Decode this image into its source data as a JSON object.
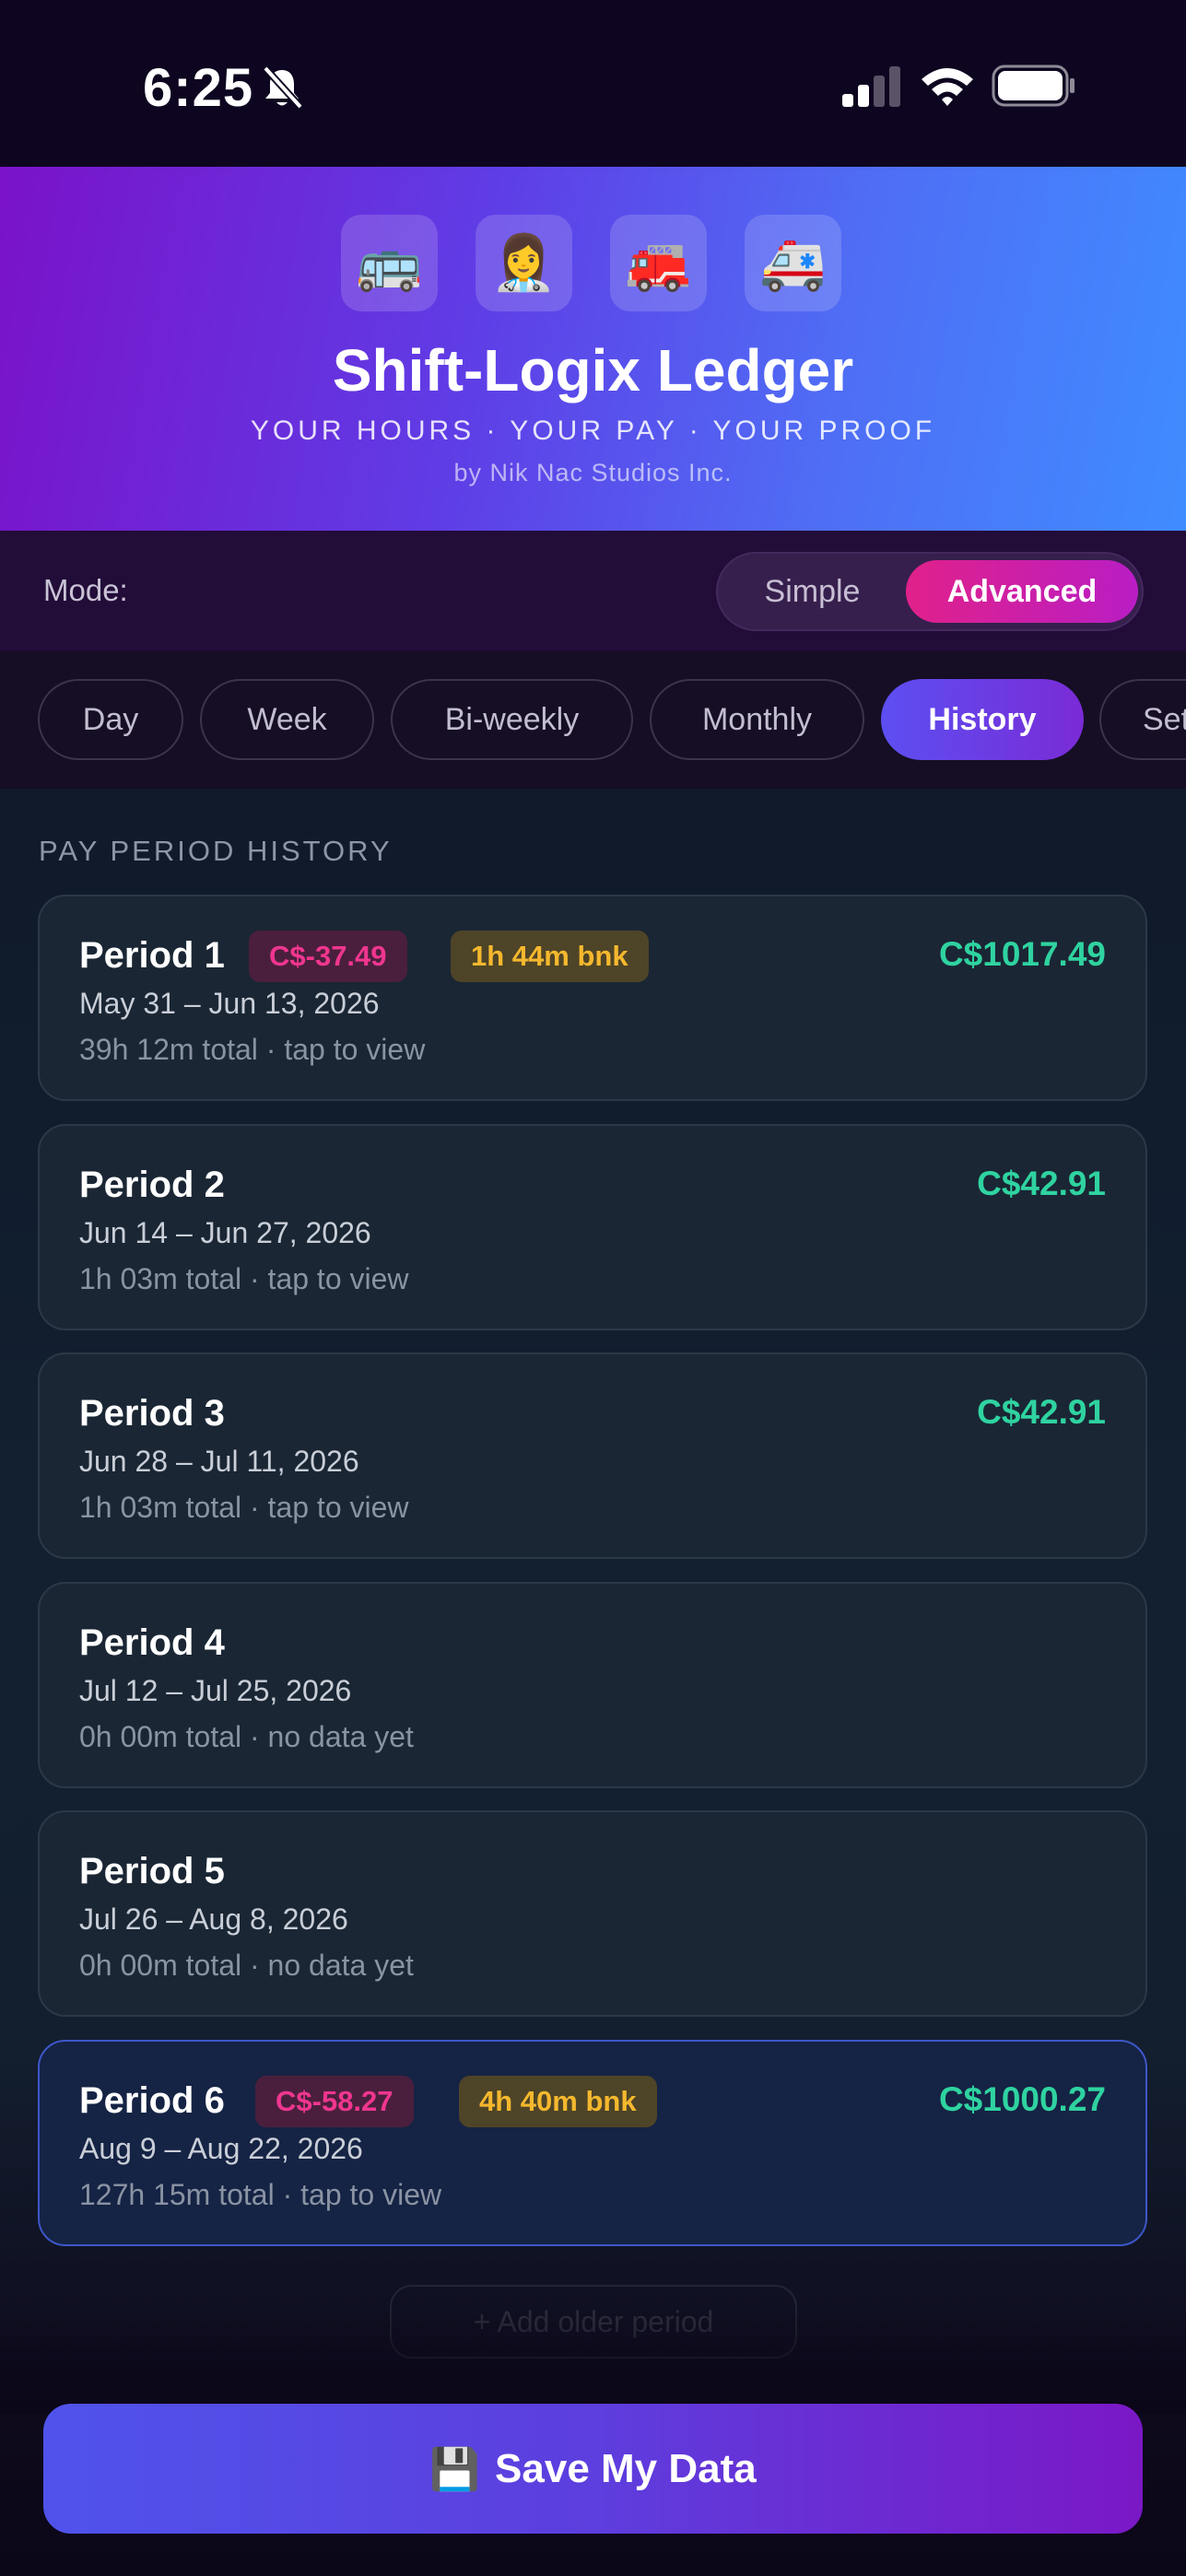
{
  "status_bar": {
    "time": "6:25"
  },
  "header": {
    "icons": [
      "🚌",
      "👩‍⚕️",
      "🚒",
      "🚑"
    ],
    "title": "Shift-Logix Ledger",
    "tagline": "YOUR HOURS · YOUR PAY · YOUR PROOF",
    "byline": "by Nik Nac Studios Inc."
  },
  "mode": {
    "label": "Mode:",
    "options": [
      "Simple",
      "Advanced"
    ],
    "selected": "Advanced"
  },
  "tabs": {
    "items": [
      "Day",
      "Week",
      "Bi-weekly",
      "Monthly",
      "History",
      "Settings"
    ],
    "active": "History"
  },
  "history": {
    "section_title": "PAY PERIOD HISTORY",
    "periods": [
      {
        "title": "Period 1",
        "diff": "C$-37.49",
        "bank": "1h 44m bnk",
        "amount": "C$1017.49",
        "dates": "May 31 – Jun 13, 2026",
        "meta": "39h 12m total · tap to view"
      },
      {
        "title": "Period 2",
        "amount": "C$42.91",
        "dates": "Jun 14 – Jun 27, 2026",
        "meta": "1h 03m total · tap to view"
      },
      {
        "title": "Period 3",
        "amount": "C$42.91",
        "dates": "Jun 28 – Jul 11, 2026",
        "meta": "1h 03m total · tap to view"
      },
      {
        "title": "Period 4",
        "dates": "Jul 12 – Jul 25, 2026",
        "meta": "0h 00m total · no data yet"
      },
      {
        "title": "Period 5",
        "dates": "Jul 26 – Aug 8, 2026",
        "meta": "0h 00m total · no data yet"
      },
      {
        "title": "Period 6",
        "diff": "C$-58.27",
        "bank": "4h 40m bnk",
        "amount": "C$1000.27",
        "dates": "Aug 9 – Aug 22, 2026",
        "meta": "127h 15m total · tap to view"
      }
    ],
    "add_older_label": "+ Add older period"
  },
  "save_button": {
    "icon": "💾",
    "label": "Save My Data"
  },
  "colors": {
    "accent_pink": "#e0218a",
    "positive_amount": "#2fd3a0",
    "negative_badge": "#f0368f",
    "bank_badge": "#f5b82e",
    "primary_button": "#5d3ede"
  }
}
